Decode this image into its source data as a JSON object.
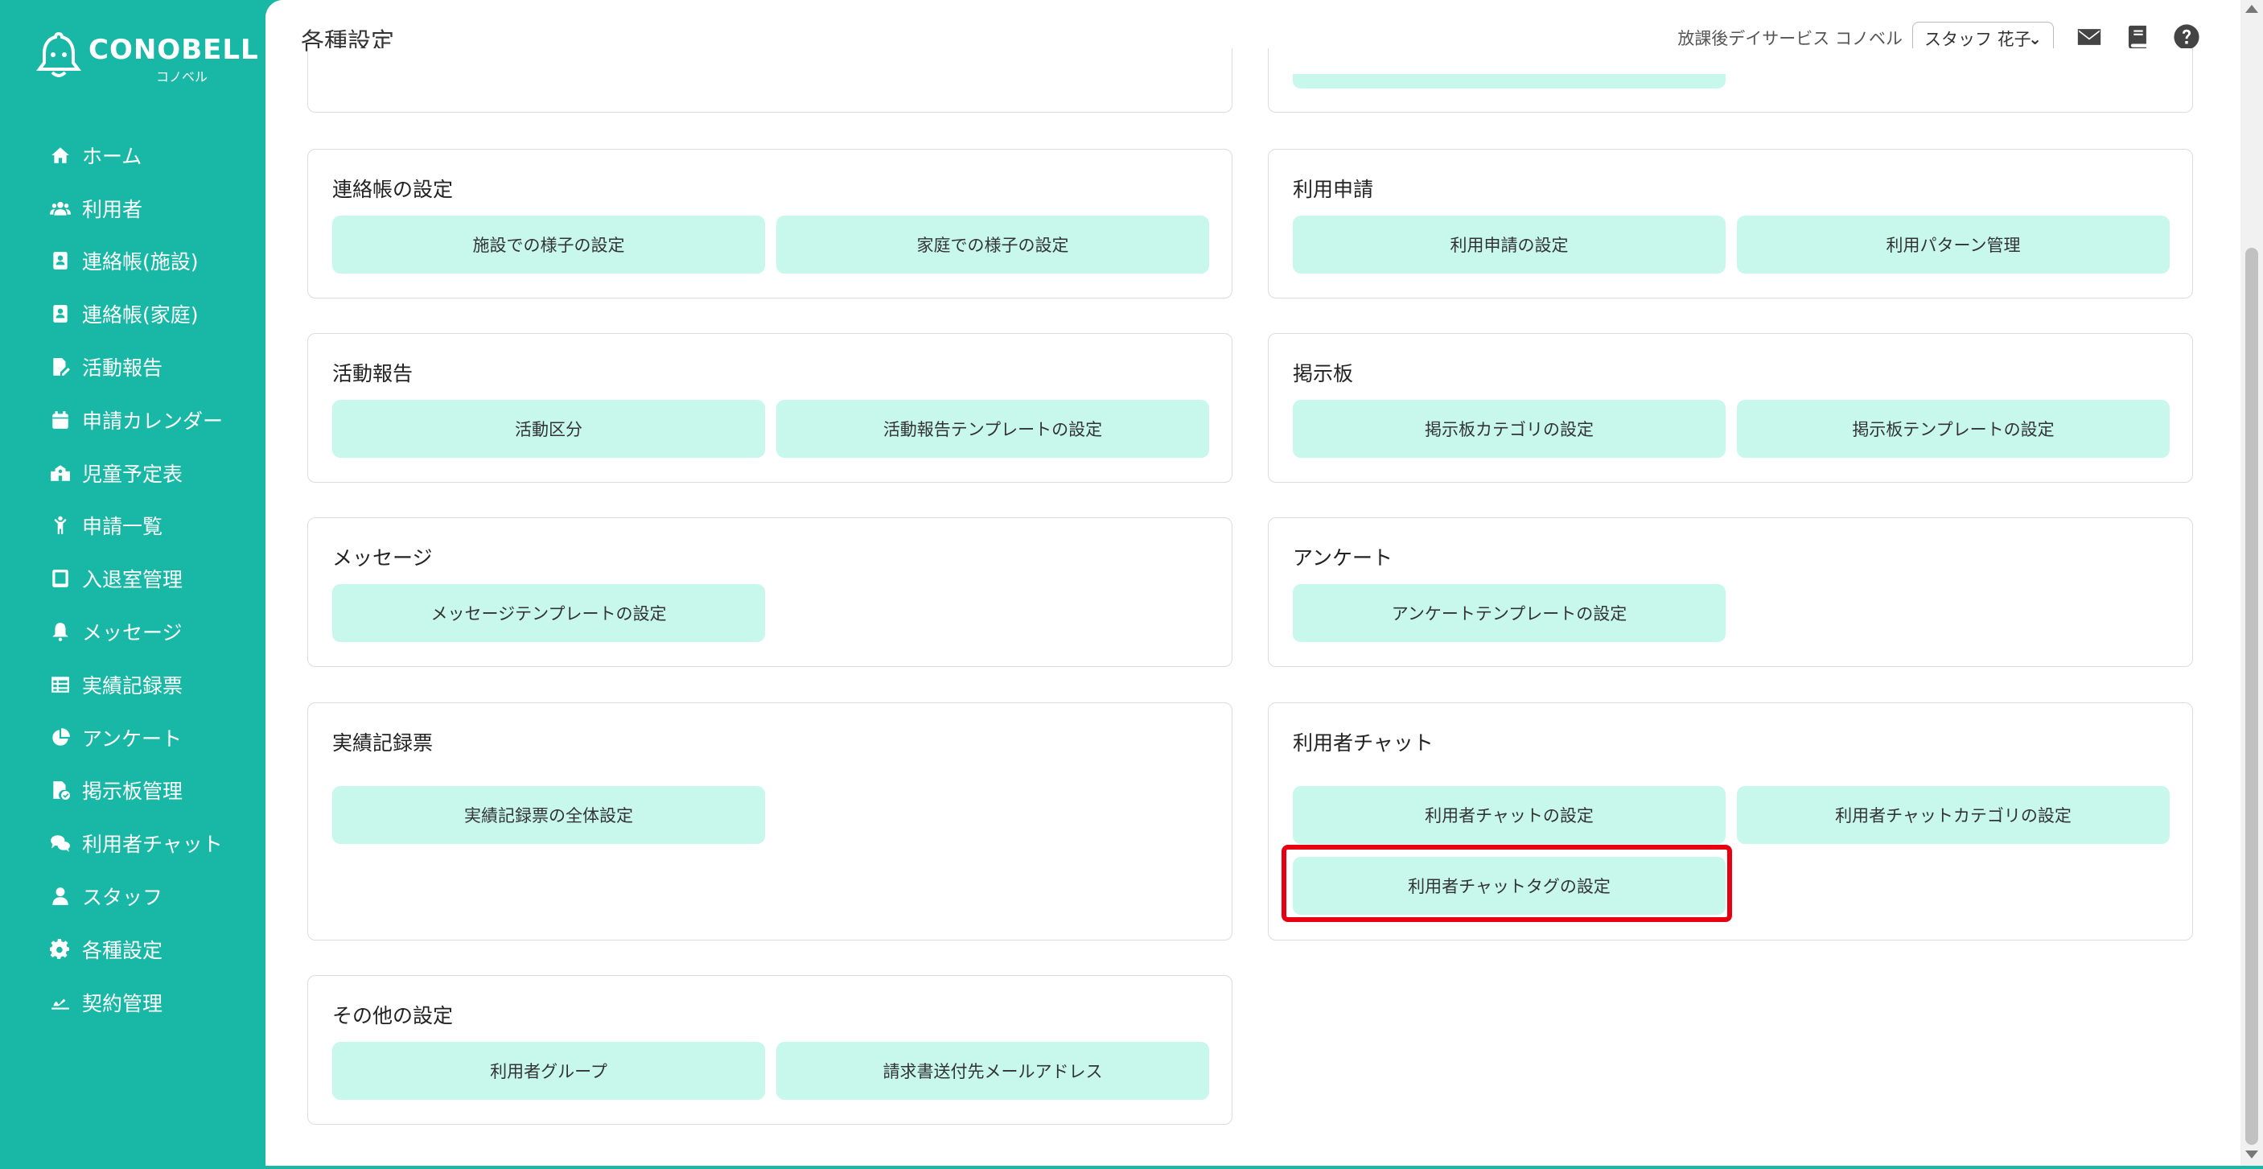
{
  "app": {
    "brand": "CONOBELL",
    "brand_sub": "コノベル"
  },
  "sidebar": {
    "items": [
      {
        "label": "ホーム",
        "icon": "home-icon"
      },
      {
        "label": "利用者",
        "icon": "users-icon"
      },
      {
        "label": "連絡帳(施設)",
        "icon": "contact-book-icon"
      },
      {
        "label": "連絡帳(家庭)",
        "icon": "contact-book-icon"
      },
      {
        "label": "活動報告",
        "icon": "edit-file-icon"
      },
      {
        "label": "申請カレンダー",
        "icon": "calendar-icon"
      },
      {
        "label": "児童予定表",
        "icon": "school-icon"
      },
      {
        "label": "申請一覧",
        "icon": "child-icon"
      },
      {
        "label": "入退室管理",
        "icon": "tablet-icon"
      },
      {
        "label": "メッセージ",
        "icon": "bell-icon"
      },
      {
        "label": "実績記録票",
        "icon": "table-icon"
      },
      {
        "label": "アンケート",
        "icon": "pie-chart-icon"
      },
      {
        "label": "掲示板管理",
        "icon": "file-check-icon"
      },
      {
        "label": "利用者チャット",
        "icon": "chat-icon"
      },
      {
        "label": "スタッフ",
        "icon": "staff-icon"
      },
      {
        "label": "各種設定",
        "icon": "gear-icon"
      },
      {
        "label": "契約管理",
        "icon": "contract-icon"
      }
    ]
  },
  "header": {
    "title": "各種設定",
    "facility": "放課後デイサービス コノベル",
    "staff_selected": "スタッフ 花子",
    "icons": [
      "mail-icon",
      "book-icon",
      "help-icon"
    ]
  },
  "sections": {
    "renrakucho": {
      "title": "連絡帳の設定",
      "buttons": [
        "施設での様子の設定",
        "家庭での様子の設定"
      ]
    },
    "riyo_shinsei": {
      "title": "利用申請",
      "buttons": [
        "利用申請の設定",
        "利用パターン管理"
      ]
    },
    "katsudo": {
      "title": "活動報告",
      "buttons": [
        "活動区分",
        "活動報告テンプレートの設定"
      ]
    },
    "keijiban": {
      "title": "掲示板",
      "buttons": [
        "掲示板カテゴリの設定",
        "掲示板テンプレートの設定"
      ]
    },
    "message": {
      "title": "メッセージ",
      "buttons": [
        "メッセージテンプレートの設定"
      ]
    },
    "enquete": {
      "title": "アンケート",
      "buttons": [
        "アンケートテンプレートの設定"
      ]
    },
    "jisseki": {
      "title": "実績記録票",
      "buttons": [
        "実績記録票の全体設定"
      ]
    },
    "chat": {
      "title": "利用者チャット",
      "buttons": [
        "利用者チャットの設定",
        "利用者チャットカテゴリの設定",
        "利用者チャットタグの設定"
      ]
    },
    "other": {
      "title": "その他の設定",
      "buttons": [
        "利用者グループ",
        "請求書送付先メールアドレス"
      ]
    }
  },
  "colors": {
    "brand": "#19b8a6",
    "button_bg": "#c8f8ec",
    "highlight": "#e60012"
  }
}
